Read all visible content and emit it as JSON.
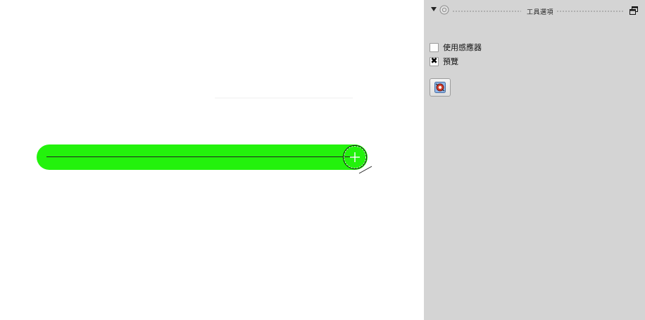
{
  "canvas": {
    "stroke_color": "#23f20c",
    "cursor_icon": "brush-outline-crosshair-icon"
  },
  "docker": {
    "title": "工具選項",
    "collapse_icon": "collapse-arrow-icon",
    "float_icon": "float-docker-icon",
    "options": [
      {
        "label": "使用感應器",
        "checked": false
      },
      {
        "label": "預覽",
        "checked": true
      }
    ],
    "tool_button_icon": "reset-tool-icon"
  }
}
